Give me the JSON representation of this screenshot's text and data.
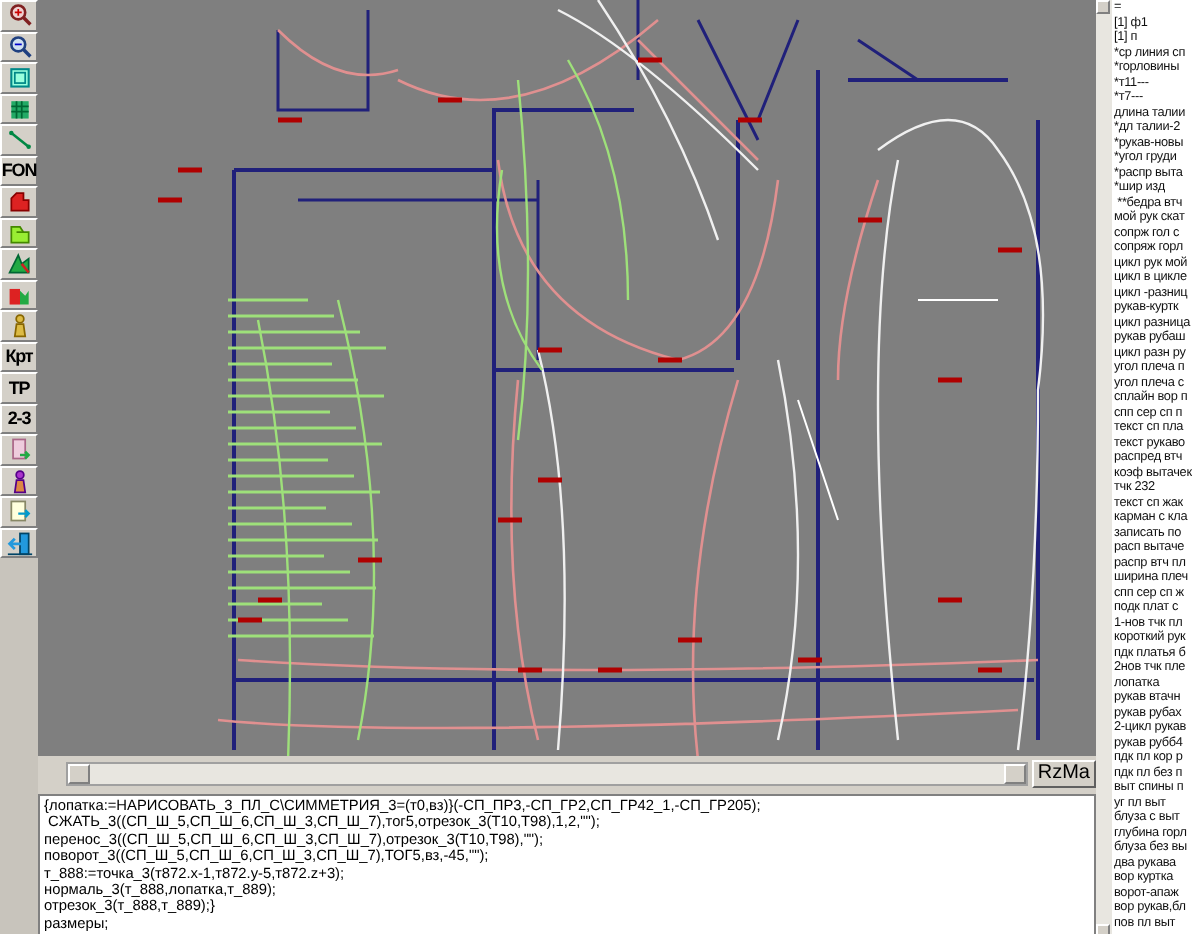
{
  "toolbar": [
    {
      "kind": "icon"
    },
    {
      "kind": "icon"
    },
    {
      "kind": "icon"
    },
    {
      "kind": "icon"
    },
    {
      "kind": "icon"
    },
    {
      "kind": "text",
      "label": "FON"
    },
    {
      "kind": "icon"
    },
    {
      "kind": "icon"
    },
    {
      "kind": "icon"
    },
    {
      "kind": "icon"
    },
    {
      "kind": "icon"
    },
    {
      "kind": "text",
      "label": "Крт"
    },
    {
      "kind": "text",
      "label": "ТР"
    },
    {
      "kind": "text",
      "label": "2-3"
    },
    {
      "kind": "icon"
    },
    {
      "kind": "icon"
    },
    {
      "kind": "icon"
    },
    {
      "kind": "icon"
    }
  ],
  "scale_button": "RzMa",
  "script_lines": [
    "{лопатка:=НАРИСОВАТЬ_3_ПЛ_С\\СИММЕТРИЯ_3=(т0,вз)}(-СП_ПР3,-СП_ГР2,СП_ГР42_1,-СП_ГР205);",
    " СЖАТЬ_3((СП_Ш_5,СП_Ш_6,СП_Ш_3,СП_Ш_7),тог5,отрезок_3(Т10,Т98),1,2,\"\");",
    "перенос_3((СП_Ш_5,СП_Ш_6,СП_Ш_3,СП_Ш_7),отрезок_3(Т10,Т98),\"\");",
    "поворот_3((СП_Ш_5,СП_Ш_6,СП_Ш_3,СП_Ш_7),ТОГ5,вз,-45,\"\");",
    "т_888:=точка_3(т872.x-1,т872.y-5,т872.z+3);",
    "нормаль_3(т_888,лопатка,т_889);",
    "отрезок_3(т_888,т_889);}",
    "размеры;"
  ],
  "list_items": [
    "=",
    "[1] ф1",
    "[1] п",
    "*ср линия сп",
    "*горловины",
    "*т11---",
    "*т7---",
    "длина талии",
    "*дл талии-2",
    "*рукав-новы",
    "*угол груди",
    "*распр выта",
    "*шир изд",
    " **бедра втч",
    "мой рук скат",
    "сопрж гол с",
    "сопряж горл",
    "цикл рук мой",
    "цикл в цикле",
    "цикл -разниц",
    "рукав-куртк",
    "цикл разница",
    "рукав рубаш",
    "цикл разн ру",
    "угол плеча п",
    "угол плеча с",
    "сплайн вор п",
    "спп сер сп п",
    "текст сп пла",
    "текст рукаво",
    "распред втч",
    "коэф вытачек",
    "тчк 232",
    "текст сп жак",
    "карман с кла",
    "записать по",
    "расп вытаче",
    "распр втч пл",
    "ширина плеч",
    "спп сер сп ж",
    "подк плат с",
    "1-нов тчк пл",
    "короткий рук",
    "пдк платья б",
    "2нов тчк пле",
    "лопатка",
    "рукав втачн",
    "рукав рубах",
    "2-цикл рукав",
    "рукав рубб4",
    "пдк пл кор р",
    "пдк пл без п",
    "выт спины п",
    "уг пл выт",
    "блуза с выт",
    "глубина горл",
    "блуза без вы",
    "два рукава",
    "вор куртка",
    "ворот-апаж",
    "вор рукав,бл",
    "пов пл выт"
  ]
}
